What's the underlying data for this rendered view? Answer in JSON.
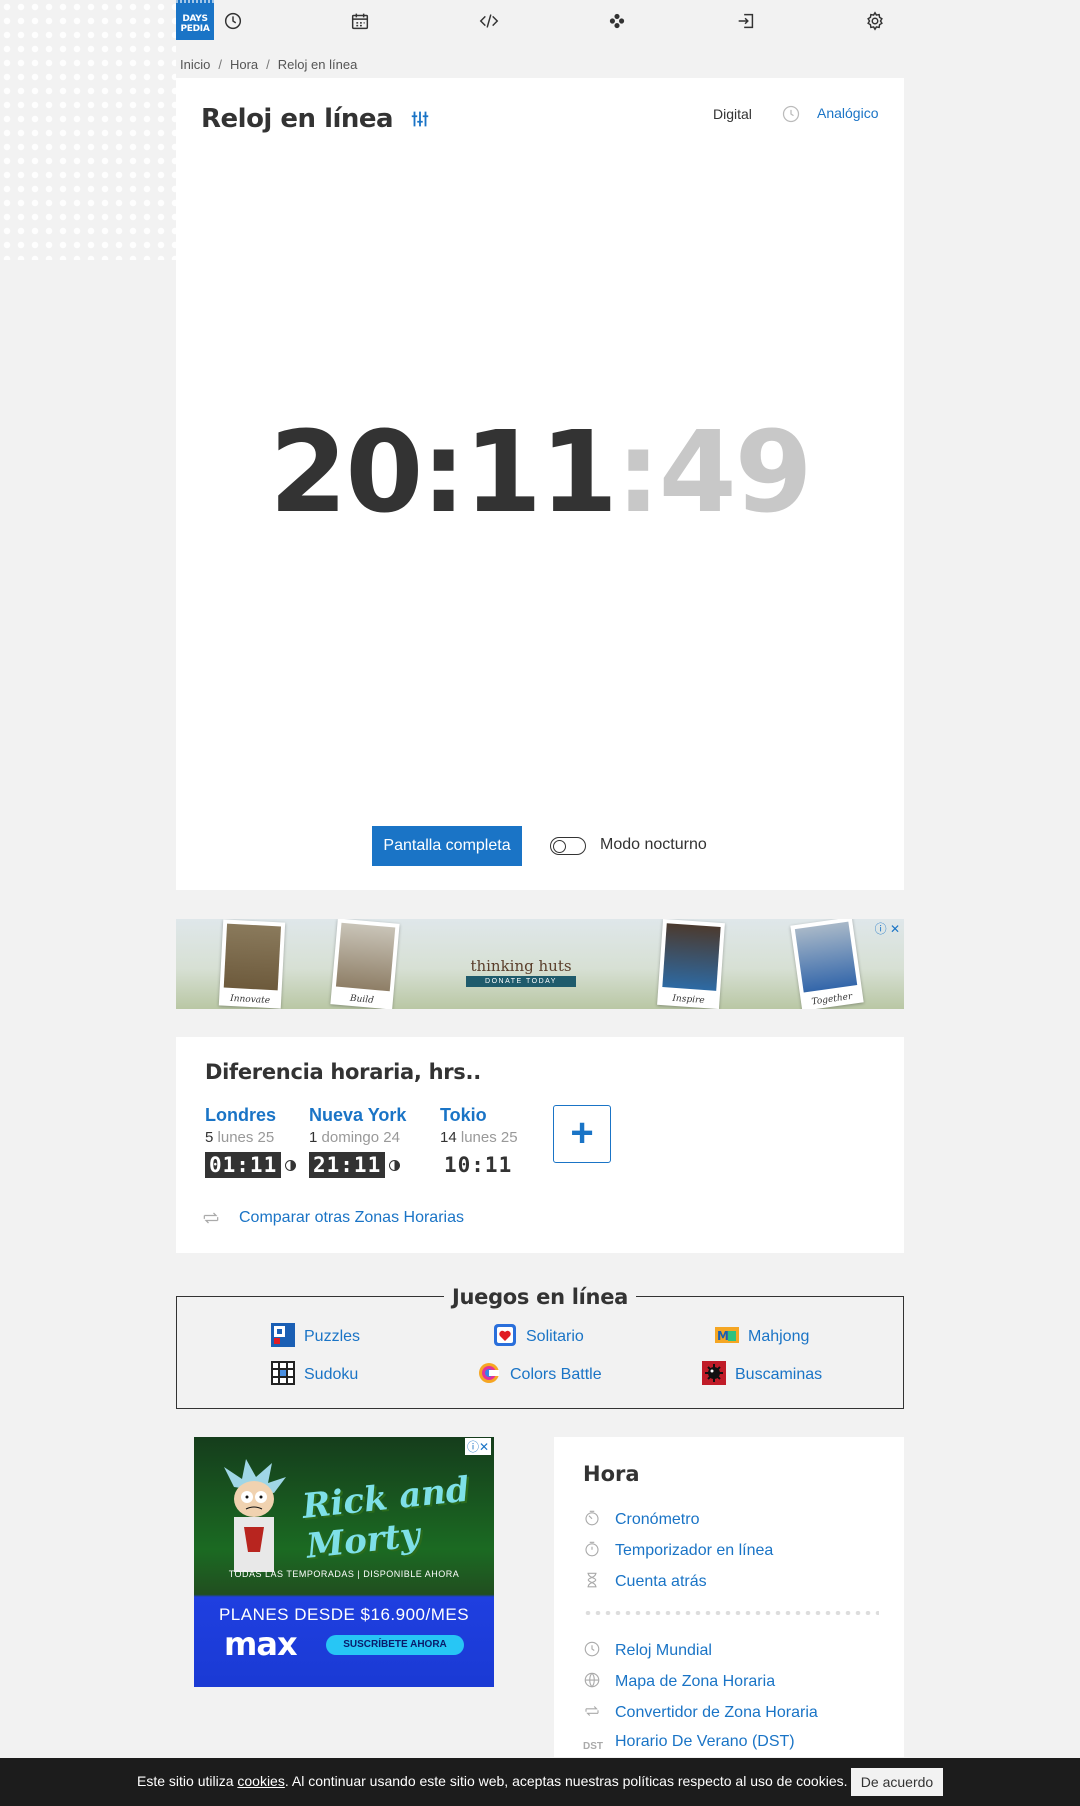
{
  "brand": {
    "logo_line1": "DAYS",
    "logo_line2": "PEDIA"
  },
  "nav_icons": [
    "clock-icon",
    "calendar-icon",
    "code-icon",
    "gamepad-icon",
    "login-icon",
    "gear-icon"
  ],
  "breadcrumb": [
    "Inicio",
    "Hora",
    "Reloj en línea"
  ],
  "clock": {
    "title": "Reloj en línea",
    "mode_digital": "Digital",
    "mode_analog": "Analógico",
    "hours_minutes": "20:11",
    "seconds": ":49",
    "fullscreen_button": "Pantalla completa",
    "night_mode_label": "Modo nocturno"
  },
  "ad_banner": {
    "brand": "thinking huts",
    "cta": "DONATE TODAY",
    "captions": [
      "Innovate",
      "Build",
      "Inspire",
      "Together"
    ]
  },
  "time_difference": {
    "title": "Diferencia horaria, hrs..",
    "cities": [
      {
        "name": "Londres",
        "offset": "5",
        "date": "lunes 25",
        "time": "01:11",
        "night": true
      },
      {
        "name": "Nueva York",
        "offset": "1",
        "date": "domingo 24",
        "time": "21:11",
        "night": true
      },
      {
        "name": "Tokio",
        "offset": "14",
        "date": "lunes 25",
        "time": "10:11",
        "night": false
      }
    ],
    "add_label": "+",
    "compare_link": "Comparar otras Zonas Horarias"
  },
  "games": {
    "title": "Juegos en línea",
    "items": [
      "Puzzles",
      "Solitario",
      "Mahjong",
      "Sudoku",
      "Colors Battle",
      "Buscaminas"
    ]
  },
  "ad_max": {
    "show": "Rick and Morty",
    "tagline": "TODAS LAS TEMPORADAS | DISPONIBLE AHORA",
    "price": "PLANES DESDE $16.900/MES",
    "brand": "max",
    "cta": "SUSCRÍBETE AHORA"
  },
  "hora": {
    "title": "Hora",
    "group1": [
      "Cronómetro",
      "Temporizador en línea",
      "Cuenta atrás"
    ],
    "group2": [
      "Reloj Mundial",
      "Mapa de Zona Horaria",
      "Convertidor de Zona Horaria",
      "Horario De Verano (DST)"
    ]
  },
  "cookie": {
    "text_before": "Este sitio utiliza ",
    "link": "cookies",
    "text_after": ". Al continuar usando este sitio web, aceptas nuestras políticas respecto al uso de cookies.",
    "button": "De acuerdo"
  },
  "colors": {
    "accent": "#1a74c6",
    "dark": "#333333",
    "cookie_bg": "#1c1c1c"
  }
}
